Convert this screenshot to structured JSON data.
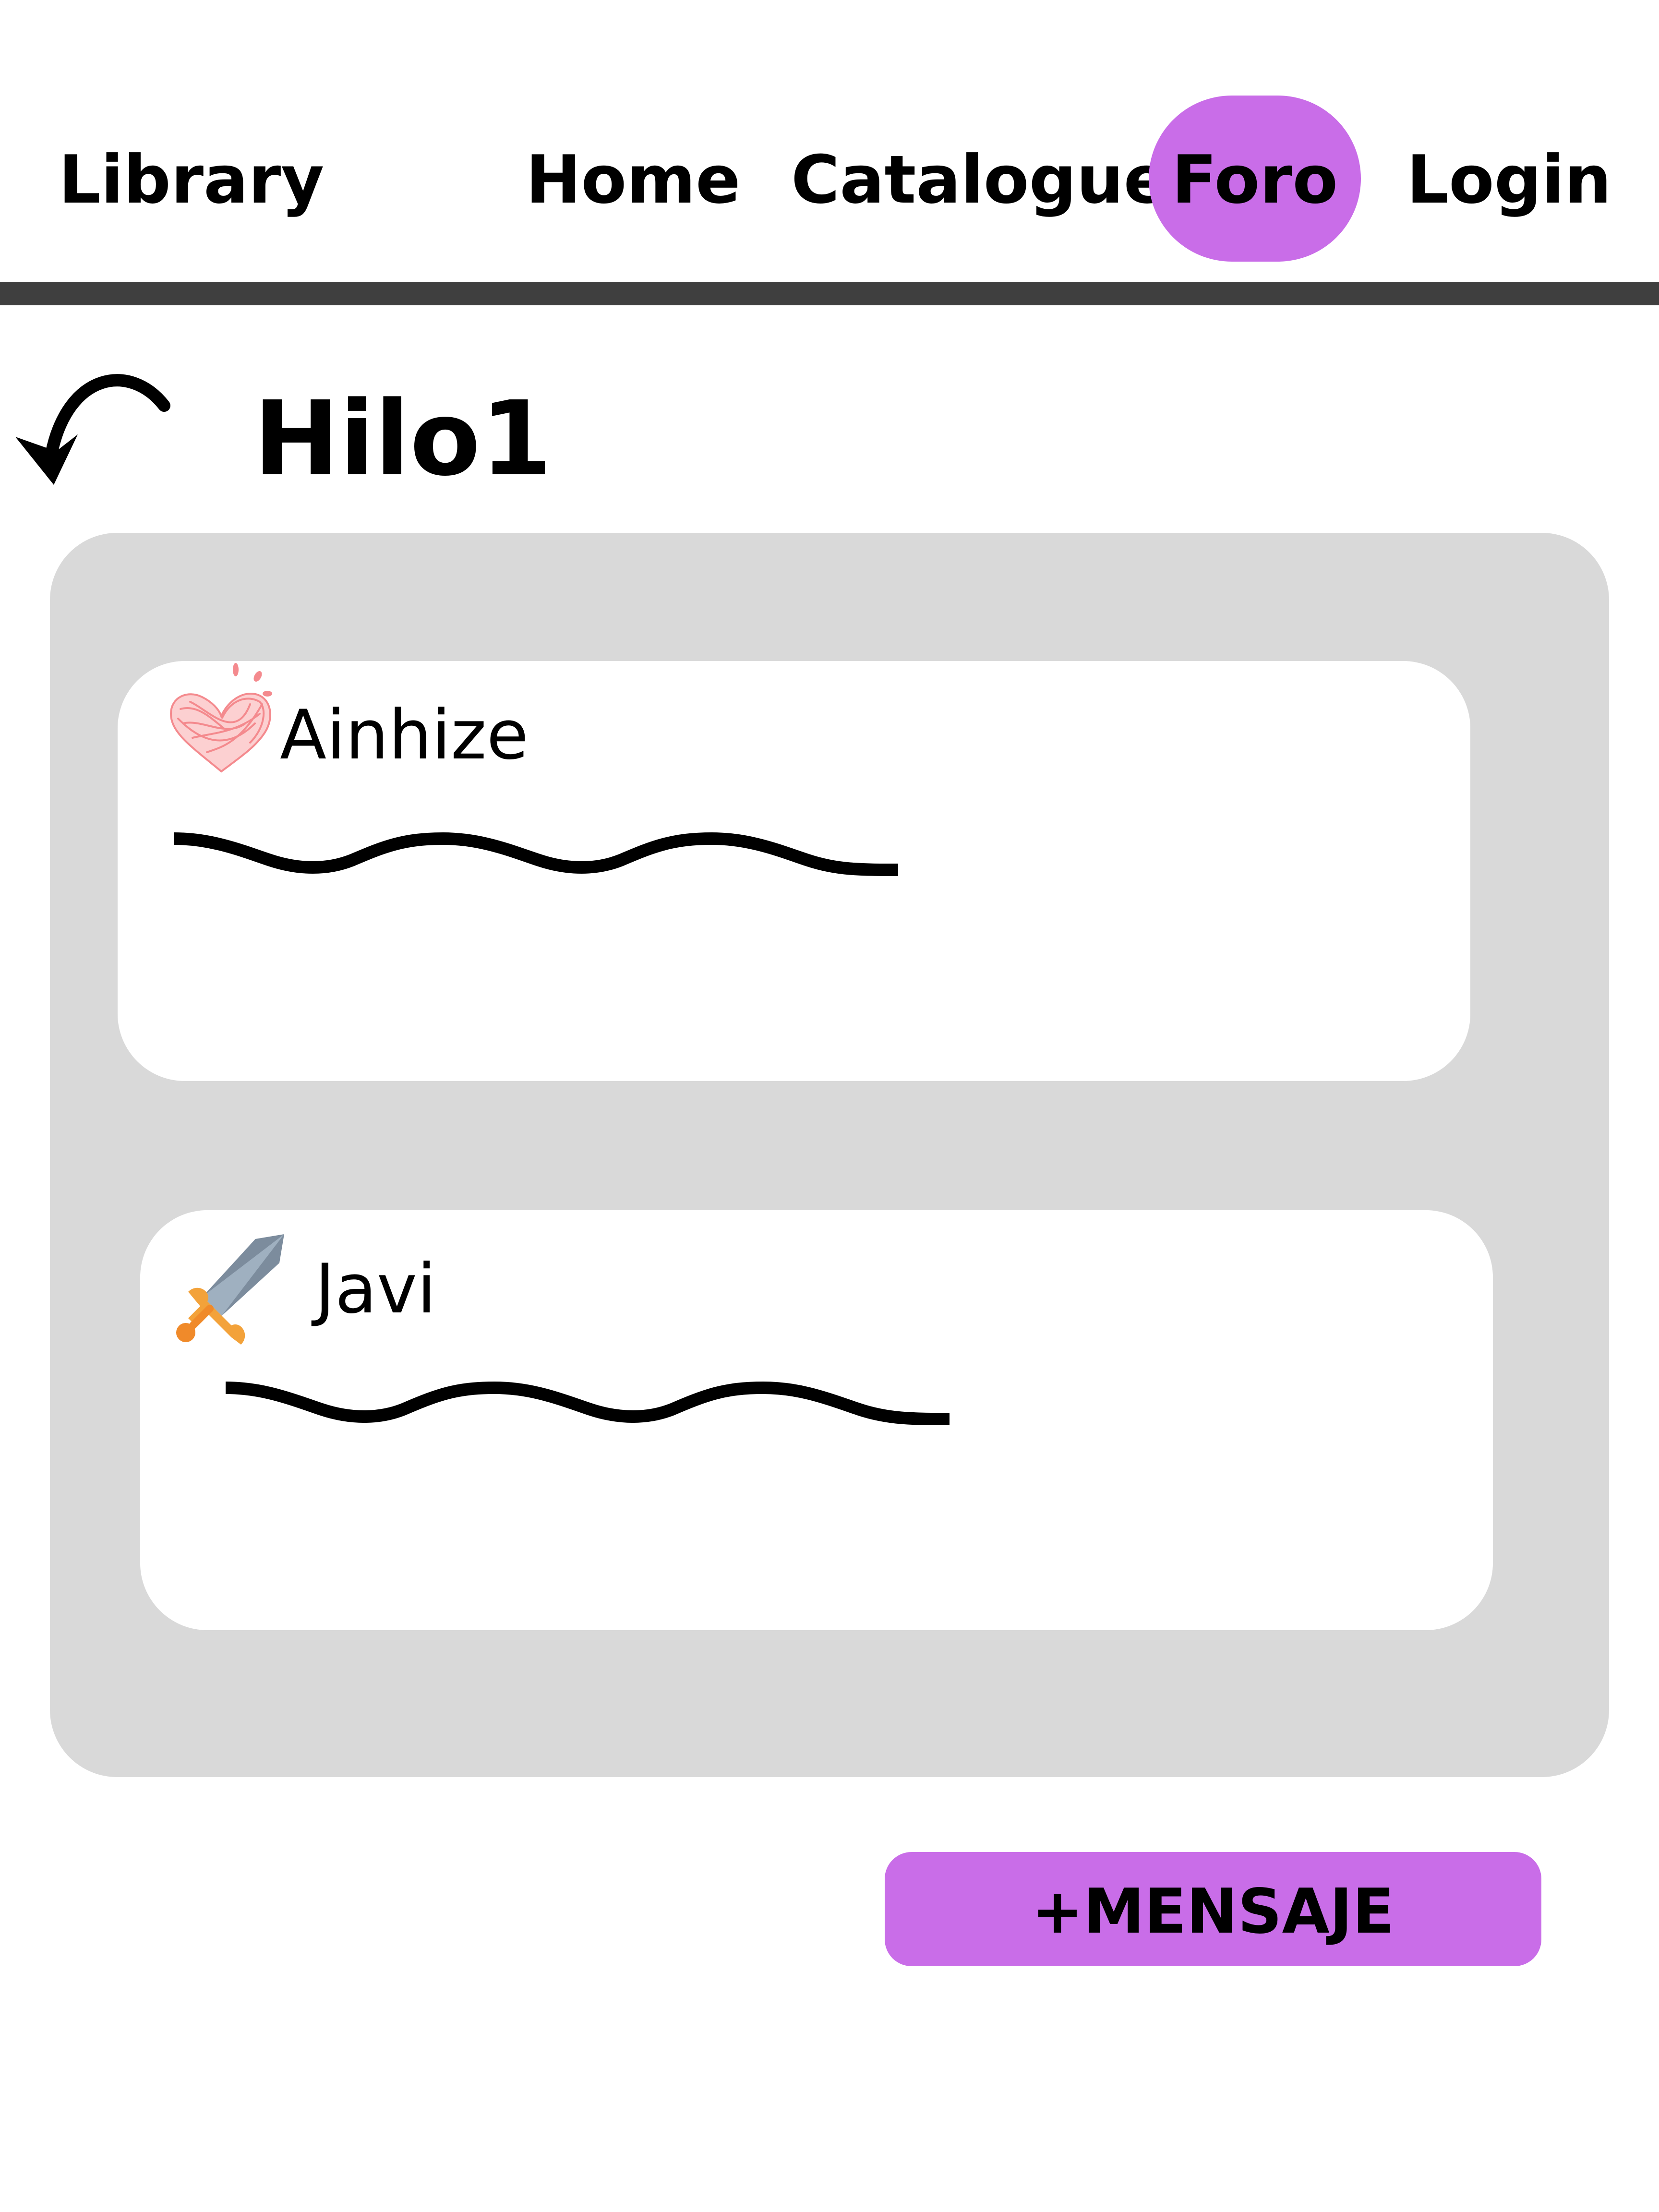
{
  "nav": {
    "brand": "Library",
    "items": [
      {
        "label": "Home",
        "active": false
      },
      {
        "label": "Catalogue",
        "active": false
      },
      {
        "label": "Foro",
        "active": true
      },
      {
        "label": "Login",
        "active": false
      }
    ],
    "active_color": "#c96de8",
    "divider_color": "#3f3f3f"
  },
  "thread": {
    "back_icon": "curved-back-arrow-icon",
    "title": "Hilo1"
  },
  "panel": {
    "background": "#d9d9d9",
    "messages": [
      {
        "author": "Ainhize",
        "avatar_icon": "scribbled-heart-icon",
        "body_icon": "wavy-line-placeholder-icon"
      },
      {
        "author": "Javi",
        "avatar_icon": "sword-icon",
        "body_icon": "wavy-line-placeholder-icon"
      }
    ]
  },
  "actions": {
    "new_message_label": "+MENSAJE"
  }
}
